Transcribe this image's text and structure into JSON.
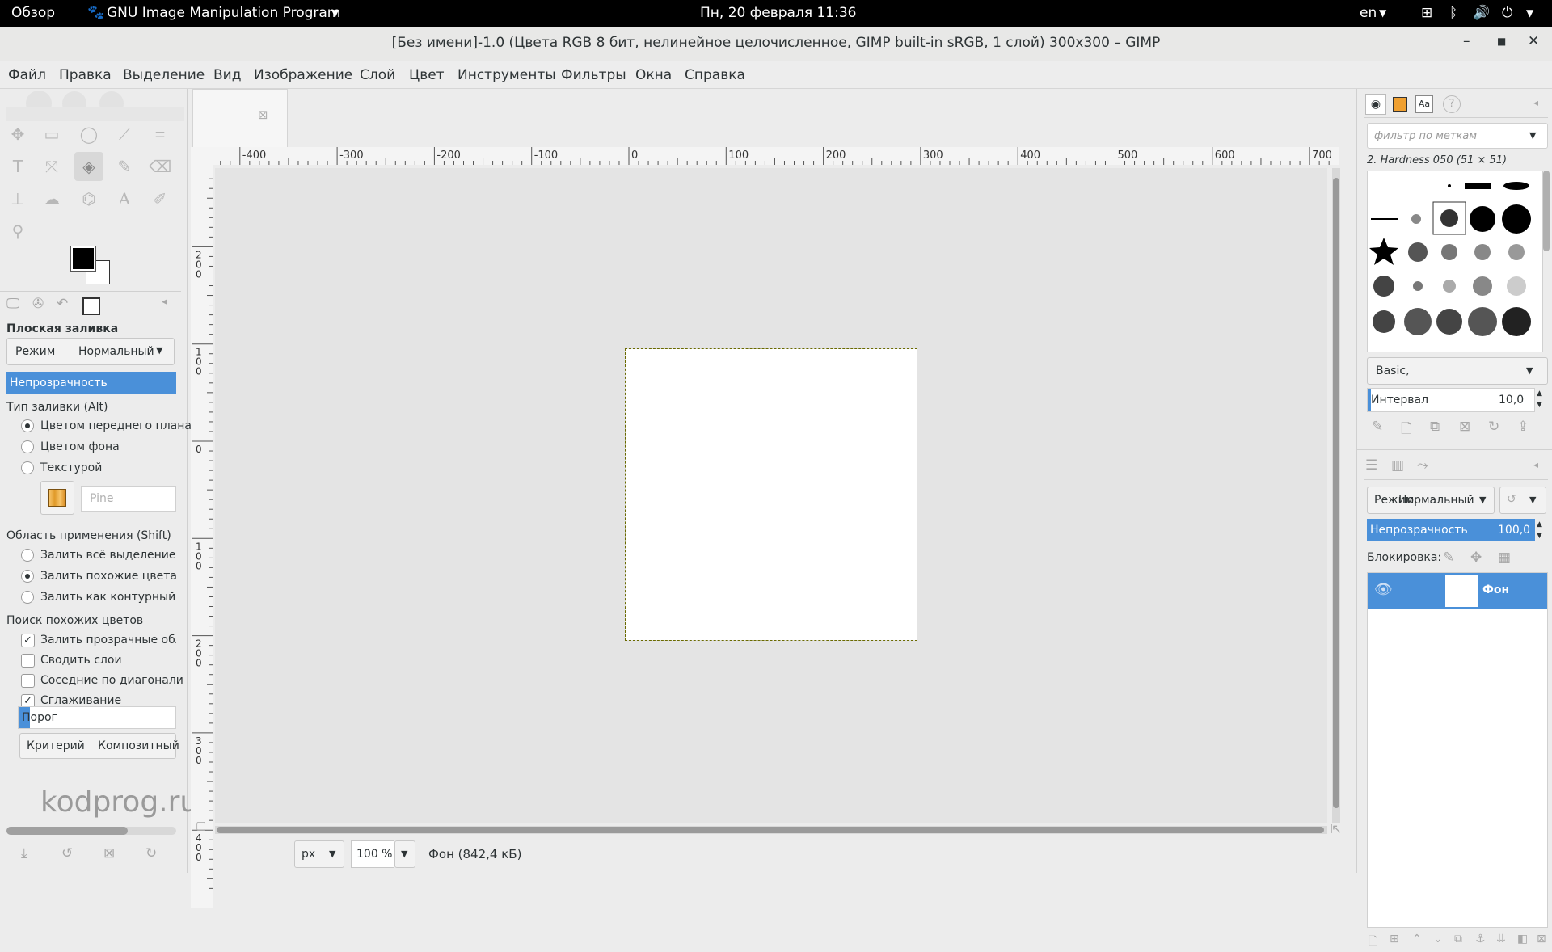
{
  "topbar": {
    "overview": "Обзор",
    "app": "GNU Image Manipulation Program",
    "clock": "Пн, 20 февраля  11:36",
    "lang": "en"
  },
  "window": {
    "title": "[Без имени]-1.0 (Цвета RGB 8 бит, нелинейное целочисленное, GIMP built-in sRGB, 1 слой) 300x300 – GIMP"
  },
  "menu": [
    "Файл",
    "Правка",
    "Выделение",
    "Вид",
    "Изображение",
    "Слой",
    "Цвет",
    "Инструменты",
    "Фильтры",
    "Окна",
    "Справка"
  ],
  "tool_options": {
    "title": "Плоская заливка",
    "mode_label": "Режим",
    "mode_value": "Нормальный",
    "opacity_label": "Непрозрачность",
    "fill_type_label": "Тип заливки  (Alt)",
    "fill_fg": "Цветом переднего плана",
    "fill_bg": "Цветом фона",
    "fill_pattern": "Текстурой",
    "pattern_name": "Pine",
    "area_label": "Область применения  (Shift)",
    "area_all": "Залить всё выделение",
    "area_similar": "Залить похожие цвета",
    "area_line": "Залить как контурный ри",
    "similar_label": "Поиск похожих цветов",
    "cb_transparent": "Залить прозрачные обла",
    "cb_merge": "Сводить слои",
    "cb_diagonal": "Соседние по диагонали",
    "cb_antialias": "Сглаживание",
    "threshold_label": "Порог",
    "criterion_label": "Критерий",
    "criterion_value": "Композитный",
    "selected_fill": "fg",
    "selected_area": "similar",
    "checks": {
      "transparent": true,
      "merge": false,
      "diagonal": false,
      "antialias": true
    }
  },
  "watermark": "kodprog.ru",
  "ruler": {
    "h": [
      "-400",
      "-300",
      "-200",
      "-100",
      "0",
      "100",
      "200",
      "300",
      "400",
      "500",
      "600",
      "700"
    ],
    "v": [
      "200",
      "100",
      "0",
      "100",
      "200",
      "300",
      "400"
    ]
  },
  "statusbar": {
    "unit": "px",
    "zoom": "100 %",
    "layer_info": "Фон (842,4 кБ)"
  },
  "brushes": {
    "filter_placeholder": "фильтр по меткам",
    "brush_name": "2. Hardness 050 (51 × 51)",
    "preset": "Basic,",
    "spacing_label": "Интервал",
    "spacing_value": "10,0"
  },
  "layers": {
    "mode_label": "Режим",
    "mode_value": "Нормальный",
    "opacity_label": "Непрозрачность",
    "opacity_value": "100,0",
    "lock_label": "Блокировка:",
    "layer_name": "Фон"
  },
  "colors": {
    "accent": "#4a90d9",
    "fg": "#000000",
    "bg": "#ffffff"
  }
}
